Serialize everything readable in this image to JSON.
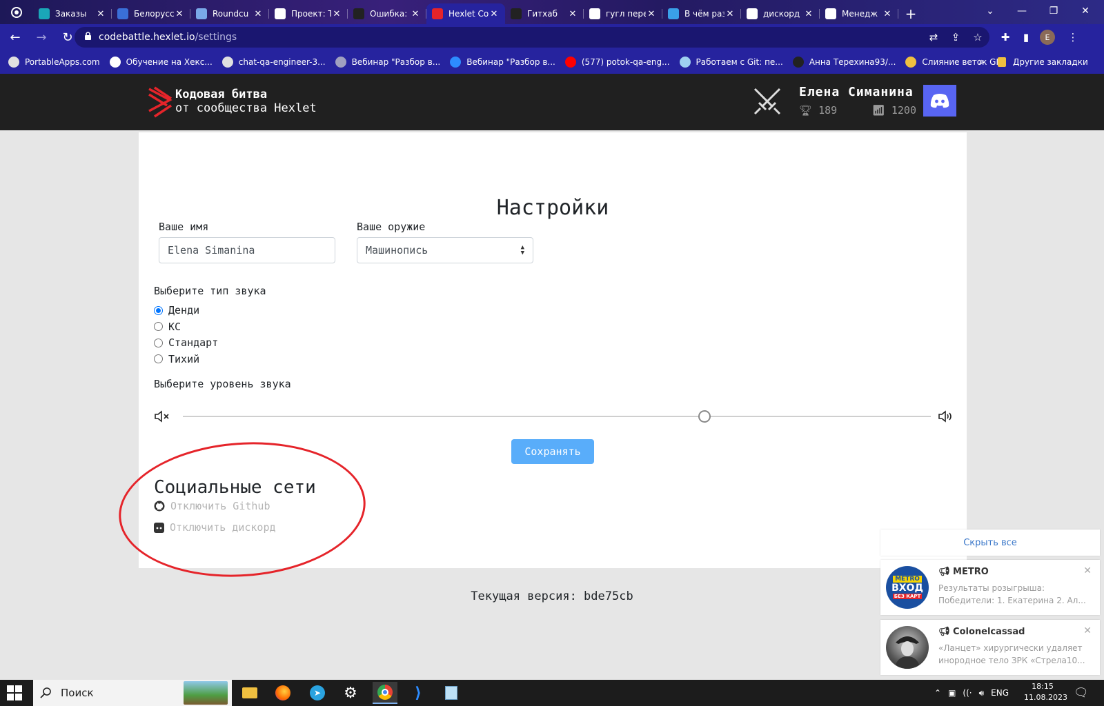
{
  "browser": {
    "tabs": [
      {
        "label": "Заказы",
        "favicon": "teal-square-icon",
        "color": "#1aa7b8"
      },
      {
        "label": "Белорусс",
        "favicon": "blue-chart-icon",
        "color": "#3a6fd8"
      },
      {
        "label": "Roundcu",
        "favicon": "roundcube-icon",
        "color": "#7aa8e8"
      },
      {
        "label": "Проект: Т",
        "favicon": "x-logo-icon",
        "color": "#ffffff"
      },
      {
        "label": "Ошибка: I",
        "favicon": "github-icon",
        "color": "#222222"
      },
      {
        "label": "Hexlet Co",
        "favicon": "hexlet-icon",
        "color": "#e5242a"
      },
      {
        "label": "Гитхаб",
        "favicon": "github-icon",
        "color": "#222222"
      },
      {
        "label": "гугл пере",
        "favicon": "google-icon",
        "color": "#ffffff"
      },
      {
        "label": "В чём раз",
        "favicon": "snowflake-icon",
        "color": "#3aa0e8"
      },
      {
        "label": "дискорд",
        "favicon": "google-icon",
        "color": "#ffffff"
      },
      {
        "label": "Менедж",
        "favicon": "google-icon",
        "color": "#ffffff"
      }
    ],
    "active_tab": 5,
    "address": {
      "host": "codebattle.hexlet.io",
      "path": "/settings"
    },
    "profile_initial": "E",
    "bookmarks": [
      {
        "label": "PortableApps.com",
        "icon": "portableapps-icon",
        "color": "#e0e0e0"
      },
      {
        "label": "Обучение на Хекс...",
        "icon": "x-logo-icon",
        "color": "#ffffff"
      },
      {
        "label": "chat-qa-engineer-3...",
        "icon": "globe-icon",
        "color": "#e0e0e0"
      },
      {
        "label": "Вебинар \"Разбор в...",
        "icon": "globe-icon",
        "color": "#a0a0c0"
      },
      {
        "label": "Вебинар \"Разбор в...",
        "icon": "zoom-icon",
        "color": "#2d8cff"
      },
      {
        "label": "(577) potok-qa-eng...",
        "icon": "youtube-icon",
        "color": "#ff0000"
      },
      {
        "label": "Работаем с Git: пе...",
        "icon": "app-icon",
        "color": "#9fd0f0"
      },
      {
        "label": "Анна Терехина93/...",
        "icon": "github-icon",
        "color": "#222222"
      },
      {
        "label": "Слияние веток GIT",
        "icon": "drive-icon",
        "color": "#f0c040"
      }
    ],
    "other_bookmarks": "Другие закладки"
  },
  "header": {
    "brand_line1": "Кодовая битва",
    "brand_line2": "от сообщества Hexlet",
    "user_name": "Елена Симанина",
    "trophies": "189",
    "rating": "1200"
  },
  "settings": {
    "title": "Настройки",
    "name_label": "Ваше имя",
    "name_value": "Elena Simanina",
    "weapon_label": "Ваше оружие",
    "weapon_value": "Машинопись",
    "sound_type_label": "Выберите тип звука",
    "sound_types": [
      "Денди",
      "КС",
      "Стандарт",
      "Тихий"
    ],
    "sound_type_selected": "Денди",
    "volume_label": "Выберите уровень звука",
    "volume_level": 0.697,
    "save_label": "Сохранять"
  },
  "social": {
    "title": "Социальные сети",
    "github_label": "Отключить Github",
    "discord_label": "Отключить дискорд"
  },
  "footer": {
    "version": "Текущая версия: bde75cb"
  },
  "notifications": {
    "hide_all": "Скрыть все",
    "items": [
      {
        "sender": "METRO",
        "text": "Результаты розыгрыша: Победители: 1. Екатерина 2. Ал...",
        "avatar": "metro-avatar-icon",
        "avatar_text": "METRO ВХОД БЕЗ КАРТ"
      },
      {
        "sender": "Colonelcassad",
        "text": "«Ланцет» хирургически удаляет инородное тело ЗРК «Стрела10...",
        "avatar": "user-avatar-icon"
      }
    ]
  },
  "taskbar": {
    "search_placeholder": "Поиск",
    "language": "ENG",
    "time": "18:15",
    "date": "11.08.2023"
  },
  "colors": {
    "accent": "#26239e",
    "save_button": "#59adfa",
    "annotation": "#e5242a",
    "discord": "#5865f2"
  }
}
